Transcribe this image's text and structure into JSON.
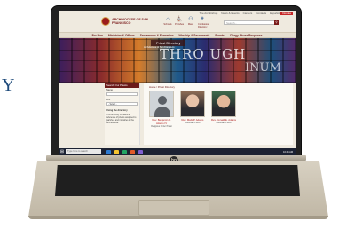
{
  "side": {
    "letter": "Y"
  },
  "site": {
    "top_links": [
      "The Archbishop",
      "News & Events",
      "Careers",
      "Contacts",
      "Español"
    ],
    "donate": "Donate",
    "brand": "ARCHDIOCESE OF SAN FRANCISCO",
    "header_icons": [
      {
        "label": "Schools",
        "icon": "school-icon"
      },
      {
        "label": "Parishes",
        "icon": "church-icon"
      },
      {
        "label": "Mass",
        "icon": "chalice-icon"
      },
      {
        "label": "Confession Directory",
        "icon": "cross-icon"
      }
    ],
    "search_placeholder": "Search...",
    "nav": [
      "For Men",
      "Ministries & Offices",
      "Sacraments & Formation",
      "Worship & Sacraments",
      "Events",
      "Clergy Abuse Response"
    ],
    "hero": {
      "tag": "Priest Directory",
      "subtitle": "Archdiocese of San Francisco",
      "title_line1": "THRO UGH",
      "title_line2": "INUM"
    },
    "sidebar": {
      "heading": "Search Our Priests",
      "label_name": "Name",
      "label_filter": "A-Z",
      "select_value": "- Select -",
      "about_title": "Using the directory",
      "about_text": "This directory contains a reference of priests assigned to parishes and ministries in the Archdiocese."
    },
    "breadcrumb": "Home / Priest Directory",
    "cards": [
      {
        "name": "Rev. Benjamin P. Adams IV",
        "role": "Religious Order Priest",
        "photo": "blank"
      },
      {
        "name": "Rev. Mark P. Adams",
        "role": "Diocesan Priest",
        "photo": "p1"
      },
      {
        "name": "Rev. Donald E. Adams",
        "role": "Diocesan Priest",
        "photo": "p2"
      }
    ]
  },
  "taskbar": {
    "search_placeholder": "Type here to search",
    "time": "10:45 AM",
    "app_colors": [
      "#2d7bd3",
      "#f4c430",
      "#1fa463",
      "#e05a2a",
      "#7f5fd1"
    ]
  },
  "laptop": {
    "brand": "hp"
  }
}
